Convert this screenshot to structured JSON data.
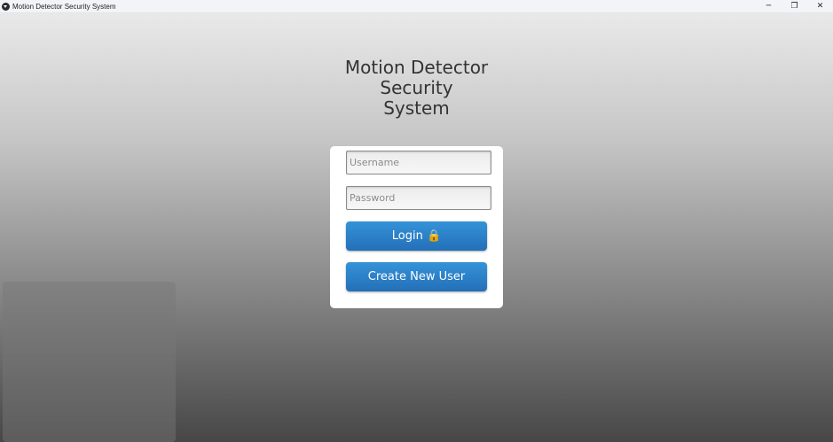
{
  "window": {
    "title": "Motion Detector Security System",
    "controls": {
      "minimize": "─",
      "restore": "❐",
      "close": "✕"
    }
  },
  "app": {
    "title_lines": [
      "Motion Detector",
      "Security",
      "System"
    ]
  },
  "login_form": {
    "username_placeholder": "Username",
    "password_placeholder": "Password",
    "login_label": "Login 🔒",
    "create_user_label": "Create New User"
  },
  "colors": {
    "button_accent": "#2a7fc8",
    "card_background": "#ffffff",
    "titlebar_background": "#f3f4f8"
  }
}
